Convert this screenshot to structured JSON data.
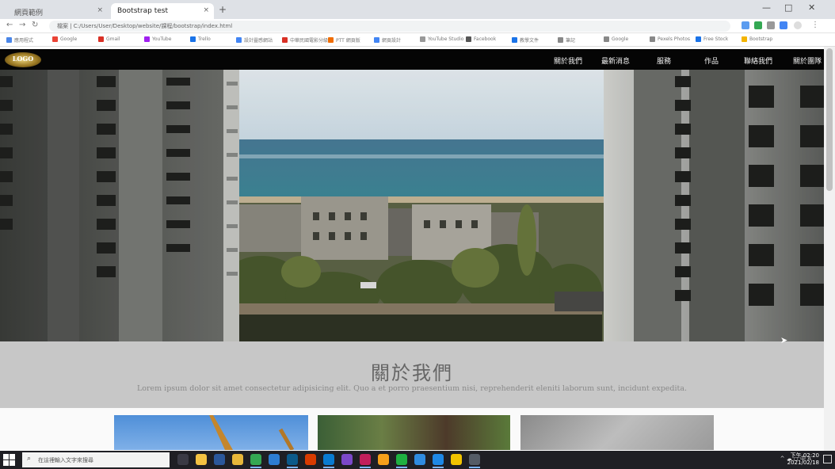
{
  "browser": {
    "tabs": [
      {
        "title": "網頁範例"
      },
      {
        "title": "Bootstrap test"
      }
    ],
    "new_tab_symbol": "+",
    "close_symbol": "×",
    "url": "檔案 | C:/Users/User/Desktop/website/課程/bootstrap/index.html",
    "bookmarks": [
      {
        "label": "應用程式",
        "color": "#4a86e8"
      },
      {
        "label": "Google",
        "color": "#ea4335"
      },
      {
        "label": "Gmail",
        "color": "#d93025"
      },
      {
        "label": "YouTube",
        "color": "#a020f0"
      },
      {
        "label": "Trello",
        "color": "#1a73e8"
      },
      {
        "label": "設計靈感網站",
        "color": "#4285f4"
      },
      {
        "label": "中華民國電影分級",
        "color": "#d93025"
      },
      {
        "label": "PTT 網頁版",
        "color": "#f06c00"
      },
      {
        "label": "網頁設計",
        "color": "#4285f4"
      },
      {
        "label": "YouTube Studio",
        "color": "#999999"
      },
      {
        "label": "Facebook",
        "color": "#555555"
      },
      {
        "label": "教學文件",
        "color": "#1a73e8"
      },
      {
        "label": "筆記",
        "color": "#888888"
      },
      {
        "label": "Google",
        "color": "#888888"
      },
      {
        "label": "Pexels Photos",
        "color": "#888888"
      },
      {
        "label": "Free Stock",
        "color": "#1a73e8"
      },
      {
        "label": "Bootstrap",
        "color": "#f4b400"
      }
    ]
  },
  "site": {
    "logo_text": "LOGO",
    "nav": [
      "關於我們",
      "最新消息",
      "服務",
      "作品",
      "聯絡我們",
      "關於團隊"
    ],
    "about": {
      "title": "關於我們",
      "text": "Lorem ipsum dolor sit amet consectetur adipisicing elit. Quo a et porro praesentium nisi, reprehenderit eleniti laborum sunt, incidunt expedita."
    }
  },
  "taskbar": {
    "search_placeholder": "在這裡輸入文字來搜尋",
    "search_icon": "search-icon",
    "apps": [
      {
        "name": "task-view-icon",
        "color": "#3a3a44"
      },
      {
        "name": "file-explorer-icon",
        "color": "#f4c242"
      },
      {
        "name": "word-icon",
        "color": "#2b579a"
      },
      {
        "name": "folder-icon",
        "color": "#e8b73a"
      },
      {
        "name": "chrome-icon",
        "color": "#34a853"
      },
      {
        "name": "photos-icon",
        "color": "#2d7dd2"
      },
      {
        "name": "terminal-icon",
        "color": "#0c5a8a"
      },
      {
        "name": "office-icon",
        "color": "#d83b01"
      },
      {
        "name": "edge-icon",
        "color": "#0a7bd1"
      },
      {
        "name": "purple-app-icon",
        "color": "#7b48c9"
      },
      {
        "name": "video-app-icon",
        "color": "#c21f5b"
      },
      {
        "name": "orange-app-icon",
        "color": "#f7a01a"
      },
      {
        "name": "green-app-icon",
        "color": "#1fb141"
      },
      {
        "name": "blue-app-icon",
        "color": "#2f8be0"
      },
      {
        "name": "vscode-icon",
        "color": "#1e88e5"
      },
      {
        "name": "yellow-app-icon",
        "color": "#f2c400"
      },
      {
        "name": "window-app-icon",
        "color": "#555c66"
      }
    ],
    "tray": "^ ☁ ◻ 中 A",
    "time": "下午 02:20",
    "date": "2021/02/18"
  }
}
